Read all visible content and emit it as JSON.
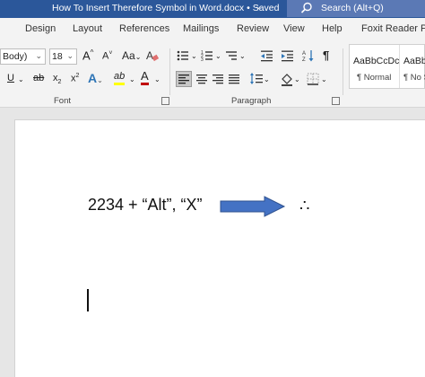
{
  "window": {
    "title": "How To Insert Therefore Symbol in Word.docx • Saved",
    "title_caret": "⌄",
    "search_placeholder": "Search (Alt+Q)"
  },
  "tabs": [
    "Design",
    "Layout",
    "References",
    "Mailings",
    "Review",
    "View",
    "Help",
    "Foxit Reader PDF"
  ],
  "ribbon": {
    "font_name": "Body)",
    "font_size": "18",
    "grow_font": "A",
    "shrink_font": "A",
    "change_case": "Aa",
    "underline": "U",
    "strikethrough": "ab",
    "subscript": "x",
    "superscript": "x",
    "text_effects": "A",
    "highlight": "ab",
    "font_color": "A",
    "paragraph_mark": "¶",
    "groups": {
      "font": "Font",
      "paragraph": "Paragraph"
    },
    "styles": [
      {
        "sample": "AaBbCcDc",
        "name": "¶ Normal"
      },
      {
        "sample": "AaBbCcDc",
        "name": "¶ No Sp"
      }
    ]
  },
  "document": {
    "line_text": "2234 + “Alt”, “X”",
    "symbol": "∴"
  },
  "colors": {
    "title_bar": "#2b579a",
    "highlight": "#ffff00",
    "font_color": "#c00000",
    "arrow_fill": "#4472c4",
    "arrow_stroke": "#2f528f"
  }
}
